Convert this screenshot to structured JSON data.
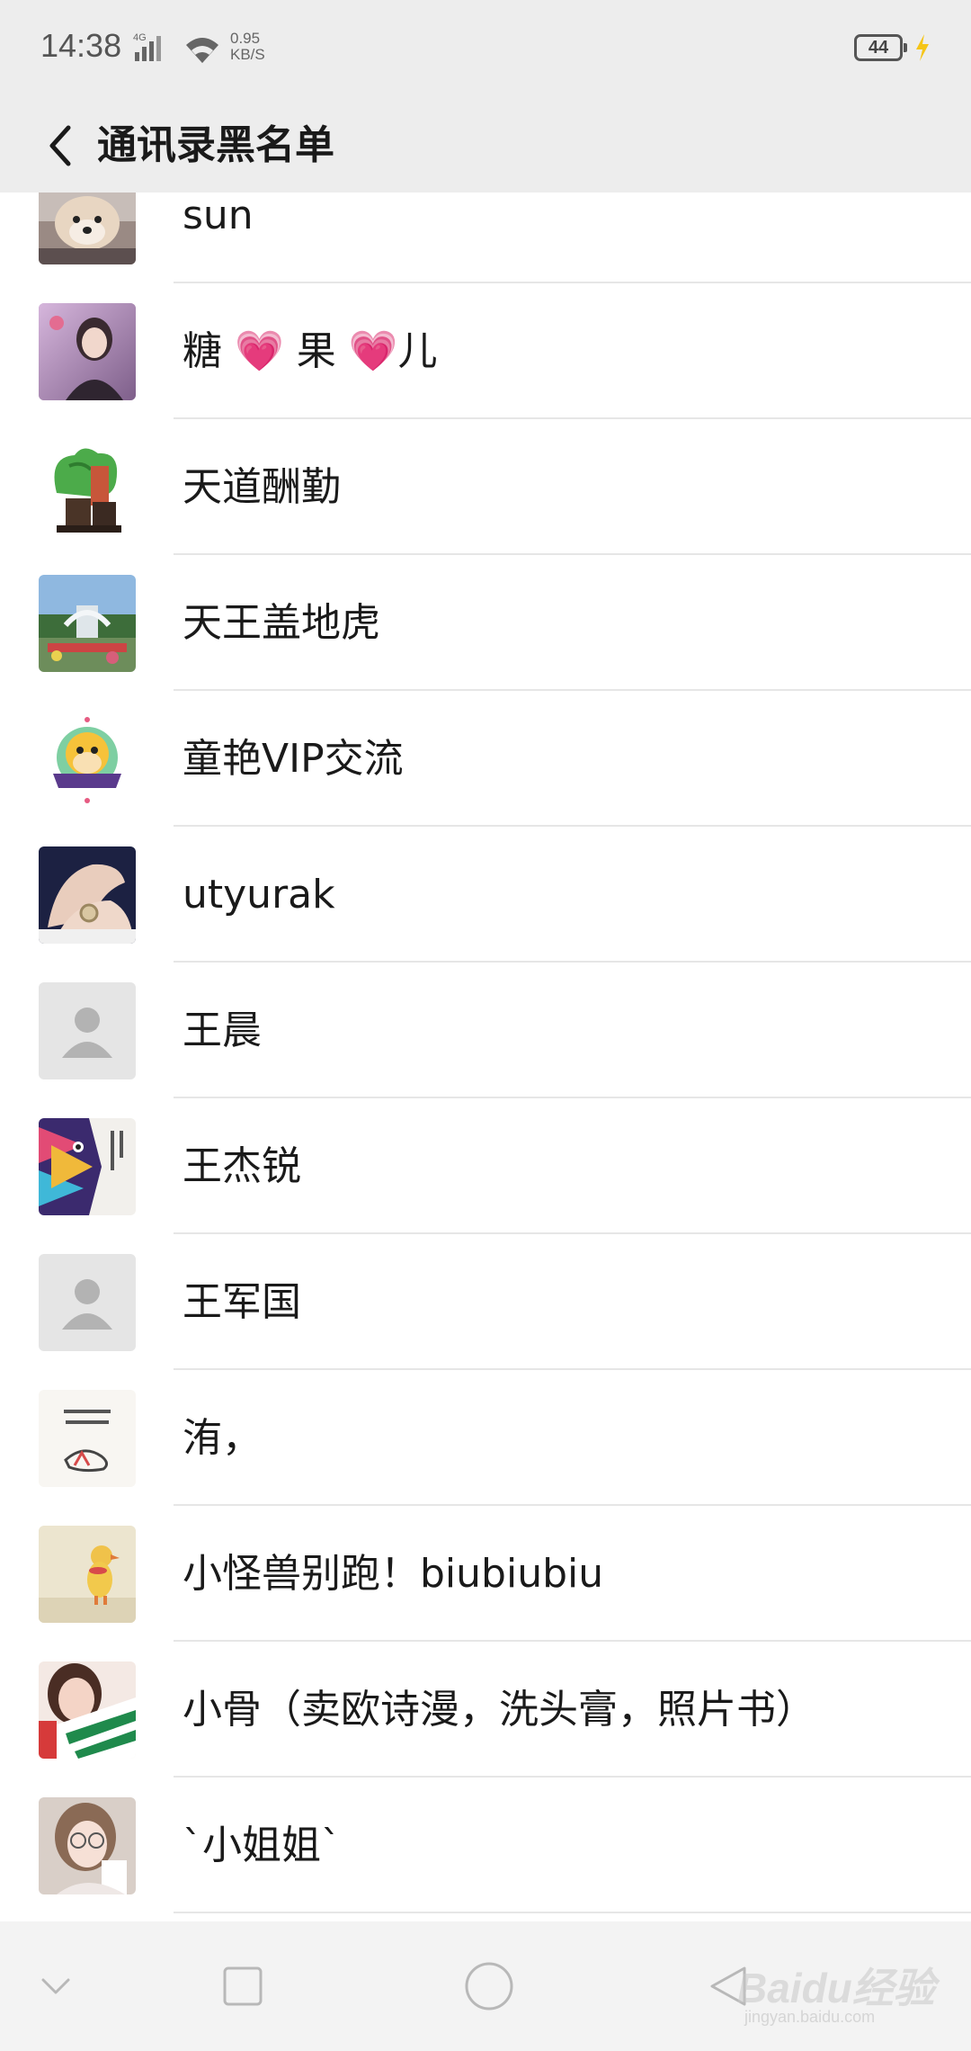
{
  "status_bar": {
    "time": "14:38",
    "network": "4G",
    "speed_value": "0.95",
    "speed_unit": "KB/S",
    "battery": "44"
  },
  "header": {
    "title": "通讯录黑名单"
  },
  "contacts": [
    {
      "name": "sun",
      "avatar": "dog-photo-avatar"
    },
    {
      "name": "糖 💗 果 💗儿",
      "avatar": "girl-photo-avatar"
    },
    {
      "name": "天道酬勤",
      "avatar": "jade-cabbage-avatar"
    },
    {
      "name": "天王盖地虎",
      "avatar": "fountain-photo-avatar"
    },
    {
      "name": "童艳VIP交流",
      "avatar": "monkey-logo-avatar"
    },
    {
      "name": "utyurak",
      "avatar": "hands-watch-avatar"
    },
    {
      "name": "王晨",
      "avatar": "default-avatar"
    },
    {
      "name": "王杰锐",
      "avatar": "book-cover-avatar"
    },
    {
      "name": "王军国",
      "avatar": "default-avatar"
    },
    {
      "name": "洧，",
      "avatar": "text-sketch-avatar"
    },
    {
      "name": "小怪兽别跑！biubiubiu",
      "avatar": "duck-illustration-avatar"
    },
    {
      "name": "小骨（卖欧诗漫，洗头膏，照片书）",
      "avatar": "girl-scarf-avatar"
    },
    {
      "name": "`小姐姐`",
      "avatar": "girl-glasses-avatar"
    }
  ],
  "nav_bar": {
    "icons": [
      "chevron-down-icon",
      "recent-apps-icon",
      "home-icon",
      "back-triangle-icon"
    ]
  },
  "watermark": {
    "brand": "Baidu经验",
    "url": "jingyan.baidu.com"
  }
}
